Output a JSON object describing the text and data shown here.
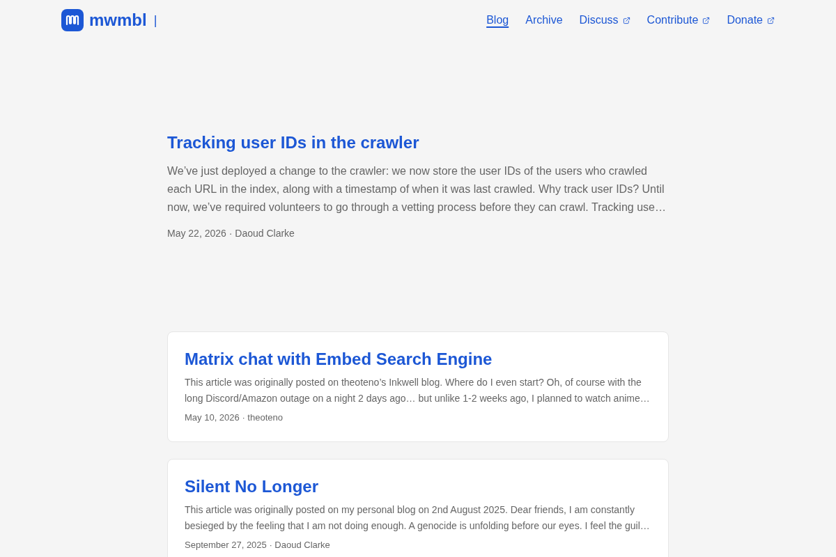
{
  "site": {
    "name": "mwmbl",
    "cursor": "|"
  },
  "nav": [
    {
      "label": "Blog",
      "selected": true,
      "external": false
    },
    {
      "label": "Archive",
      "selected": false,
      "external": false
    },
    {
      "label": "Discuss",
      "selected": false,
      "external": true
    },
    {
      "label": "Contribute",
      "selected": false,
      "external": true
    },
    {
      "label": "Donate",
      "selected": false,
      "external": true
    }
  ],
  "featured_post": {
    "title": "Tracking user IDs in the crawler",
    "excerpt": "We’ve just deployed a change to the crawler: we now store the user IDs of the users who crawled each URL in the index, along with a timestamp of when it was last crawled. Why track user IDs? Until now, we’ve required volunteers to go through a vetting process before they can crawl. Tracking use…",
    "byline": "May 22, 2026 · Daoud Clarke"
  },
  "posts": [
    {
      "title": "Matrix chat with Embed Search Engine",
      "excerpt": "This article was originally posted on theoteno’s Inkwell blog. Where do I even start? Oh, of course with the long Discord/Amazon outage on a night 2 days ago… but unlike 1-2 weeks ago, I planned to watch anime…",
      "byline": "May 10, 2026 · theoteno"
    },
    {
      "title": "Silent No Longer",
      "excerpt": "This article was originally posted on my personal blog on 2nd August 2025. Dear friends, I am constantly besieged by the feeling that I am not doing enough. A genocide is unfolding before our eyes. I feel the guil…",
      "byline": "September 27, 2025 · Daoud Clarke"
    }
  ]
}
